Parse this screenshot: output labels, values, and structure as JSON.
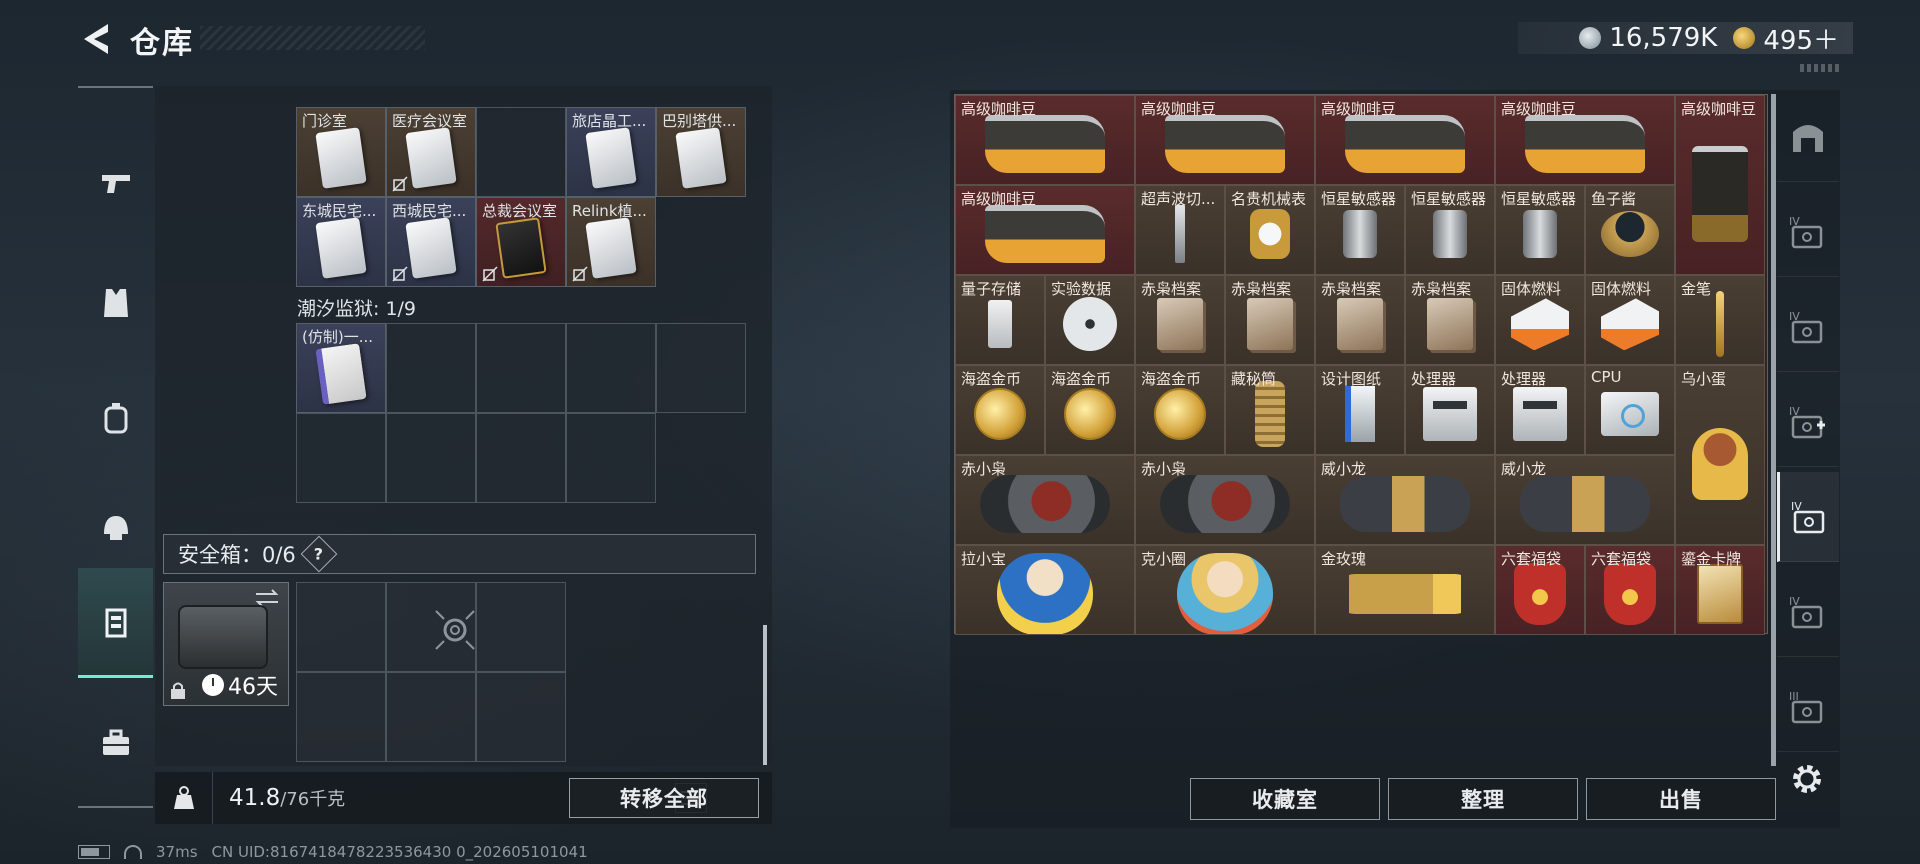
{
  "header": {
    "title": "仓库",
    "currencies": [
      {
        "icon": "silver-coin-icon",
        "value": "16,579K"
      },
      {
        "icon": "gold-coin-icon",
        "value": "495＋"
      }
    ]
  },
  "sidebar": {
    "items": [
      {
        "name": "pistol-icon",
        "active": false
      },
      {
        "name": "vest-icon",
        "active": false
      },
      {
        "name": "backpack-icon",
        "active": false
      },
      {
        "name": "helmet-icon",
        "active": false
      },
      {
        "name": "safebox-icon",
        "active": true
      },
      {
        "name": "toolbox-icon",
        "active": false
      }
    ]
  },
  "stash": {
    "keycards": [
      {
        "label": "门诊室",
        "color": "brown",
        "nocopy": false
      },
      {
        "label": "医疗会议室",
        "color": "brown",
        "nocopy": true
      },
      {
        "label": "",
        "color": "empty",
        "nocopy": false
      },
      {
        "label": "旅店晶工...",
        "color": "blue",
        "nocopy": false
      },
      {
        "label": "巴别塔供...",
        "color": "brown",
        "nocopy": false
      },
      {
        "label": "东城民宅...",
        "color": "blue",
        "nocopy": false
      },
      {
        "label": "西城民宅...",
        "color": "blue",
        "nocopy": true
      },
      {
        "label": "总裁会议室",
        "color": "red",
        "nocopy": true
      },
      {
        "label": "Relink植...",
        "color": "brown",
        "nocopy": true
      }
    ],
    "prison_label": "潮汐监狱: 1/9",
    "prison_items": [
      {
        "label": "(仿制)一..."
      }
    ],
    "safebox": {
      "label": "安全箱：0/6",
      "help": "?",
      "timer": "46天"
    },
    "weight": {
      "current": "41.8",
      "max": "/76千克"
    },
    "transfer_all": "转移全部"
  },
  "status_bar": {
    "ping": "37ms",
    "uid": "CN UID:8167418478223536430 0_202605101041"
  },
  "container_items": [
    {
      "label": "高级咖啡豆",
      "col": 0,
      "row": 0,
      "w": 2,
      "h": 1,
      "color": "red",
      "icon": "bag"
    },
    {
      "label": "高级咖啡豆",
      "col": 2,
      "row": 0,
      "w": 2,
      "h": 1,
      "color": "red",
      "icon": "bag"
    },
    {
      "label": "高级咖啡豆",
      "col": 4,
      "row": 0,
      "w": 2,
      "h": 1,
      "color": "red",
      "icon": "bag"
    },
    {
      "label": "高级咖啡豆",
      "col": 6,
      "row": 0,
      "w": 2,
      "h": 1,
      "color": "red",
      "icon": "bag"
    },
    {
      "label": "高级咖啡豆",
      "col": 8,
      "row": 0,
      "w": 1,
      "h": 2,
      "color": "red",
      "icon": "bag tall"
    },
    {
      "label": "高级咖啡豆",
      "col": 0,
      "row": 1,
      "w": 2,
      "h": 1,
      "color": "red",
      "icon": "bag"
    },
    {
      "label": "超声波切...",
      "col": 2,
      "row": 1,
      "w": 1,
      "h": 1,
      "color": "gold",
      "icon": "knife"
    },
    {
      "label": "名贵机械表",
      "col": 3,
      "row": 1,
      "w": 1,
      "h": 1,
      "color": "gold",
      "icon": "watch"
    },
    {
      "label": "恒星敏感器",
      "col": 4,
      "row": 1,
      "w": 1,
      "h": 1,
      "color": "gold",
      "icon": "sensor"
    },
    {
      "label": "恒星敏感器",
      "col": 5,
      "row": 1,
      "w": 1,
      "h": 1,
      "color": "gold",
      "icon": "sensor"
    },
    {
      "label": "恒星敏感器",
      "col": 6,
      "row": 1,
      "w": 1,
      "h": 1,
      "color": "gold",
      "icon": "sensor"
    },
    {
      "label": "鱼子酱",
      "col": 7,
      "row": 1,
      "w": 1,
      "h": 1,
      "color": "gold",
      "icon": "tin"
    },
    {
      "label": "量子存储",
      "col": 0,
      "row": 2,
      "w": 1,
      "h": 1,
      "color": "gold",
      "icon": "usb"
    },
    {
      "label": "实验数据",
      "col": 1,
      "row": 2,
      "w": 1,
      "h": 1,
      "color": "gold",
      "icon": "disc"
    },
    {
      "label": "赤枭档案",
      "col": 2,
      "row": 2,
      "w": 1,
      "h": 1,
      "color": "gold",
      "icon": "dossier"
    },
    {
      "label": "赤枭档案",
      "col": 3,
      "row": 2,
      "w": 1,
      "h": 1,
      "color": "gold",
      "icon": "dossier"
    },
    {
      "label": "赤枭档案",
      "col": 4,
      "row": 2,
      "w": 1,
      "h": 1,
      "color": "gold",
      "icon": "dossier"
    },
    {
      "label": "赤枭档案",
      "col": 5,
      "row": 2,
      "w": 1,
      "h": 1,
      "color": "gold",
      "icon": "dossier"
    },
    {
      "label": "固体燃料",
      "col": 6,
      "row": 2,
      "w": 1,
      "h": 1,
      "color": "gold",
      "icon": "fuel"
    },
    {
      "label": "固体燃料",
      "col": 7,
      "row": 2,
      "w": 1,
      "h": 1,
      "color": "gold",
      "icon": "fuel"
    },
    {
      "label": "金笔",
      "col": 8,
      "row": 2,
      "w": 1,
      "h": 1,
      "color": "gold",
      "icon": "pen"
    },
    {
      "label": "海盗金币",
      "col": 0,
      "row": 3,
      "w": 1,
      "h": 1,
      "color": "gold",
      "icon": "coinimg"
    },
    {
      "label": "海盗金币",
      "col": 1,
      "row": 3,
      "w": 1,
      "h": 1,
      "color": "gold",
      "icon": "coinimg"
    },
    {
      "label": "海盗金币",
      "col": 2,
      "row": 3,
      "w": 1,
      "h": 1,
      "color": "gold",
      "icon": "coinimg"
    },
    {
      "label": "藏秘筒",
      "col": 3,
      "row": 3,
      "w": 1,
      "h": 1,
      "color": "gold",
      "icon": "scroll"
    },
    {
      "label": "设计图纸",
      "col": 4,
      "row": 3,
      "w": 1,
      "h": 1,
      "color": "gold",
      "icon": "paper"
    },
    {
      "label": "处理器",
      "col": 5,
      "row": 3,
      "w": 1,
      "h": 1,
      "color": "gold",
      "icon": "cpu-box"
    },
    {
      "label": "处理器",
      "col": 6,
      "row": 3,
      "w": 1,
      "h": 1,
      "color": "gold",
      "icon": "cpu-box"
    },
    {
      "label": "CPU",
      "col": 7,
      "row": 3,
      "w": 1,
      "h": 1,
      "color": "gold",
      "icon": "chip"
    },
    {
      "label": "乌小蛋",
      "col": 8,
      "row": 3,
      "w": 1,
      "h": 2,
      "color": "gold",
      "icon": "figure egg"
    },
    {
      "label": "赤小枭",
      "col": 0,
      "row": 4,
      "w": 2,
      "h": 1,
      "color": "gold",
      "icon": "figure bird"
    },
    {
      "label": "赤小枭",
      "col": 2,
      "row": 4,
      "w": 2,
      "h": 1,
      "color": "gold",
      "icon": "figure bird"
    },
    {
      "label": "威小龙",
      "col": 4,
      "row": 4,
      "w": 2,
      "h": 1,
      "color": "gold",
      "icon": "figure dragon"
    },
    {
      "label": "威小龙",
      "col": 6,
      "row": 4,
      "w": 2,
      "h": 1,
      "color": "gold",
      "icon": "figure dragon"
    },
    {
      "label": "拉小宝",
      "col": 0,
      "row": 5,
      "w": 2,
      "h": 1,
      "color": "gold",
      "icon": "figure kid"
    },
    {
      "label": "克小圈",
      "col": 2,
      "row": 5,
      "w": 2,
      "h": 1,
      "color": "gold",
      "icon": "figure kid2"
    },
    {
      "label": "金玫瑰",
      "col": 4,
      "row": 5,
      "w": 2,
      "h": 1,
      "color": "gold",
      "icon": "rose"
    },
    {
      "label": "六套福袋",
      "col": 6,
      "row": 5,
      "w": 1,
      "h": 1,
      "color": "red",
      "icon": "lucky"
    },
    {
      "label": "六套福袋",
      "col": 7,
      "row": 5,
      "w": 1,
      "h": 1,
      "color": "red",
      "icon": "lucky"
    },
    {
      "label": "鎏金卡牌",
      "col": 8,
      "row": 5,
      "w": 1,
      "h": 1,
      "color": "red",
      "icon": "card-gold"
    }
  ],
  "actions": {
    "collection": "收藏室",
    "sort": "整理",
    "sell": "出售"
  },
  "right_sidebar": {
    "items": [
      {
        "name": "home-base-icon",
        "active": false
      },
      {
        "name": "tier-iv-case-icon",
        "active": false
      },
      {
        "name": "tier-iv-case-icon",
        "active": false
      },
      {
        "name": "tier-iv-medkit-icon",
        "active": false
      },
      {
        "name": "tier-iv-case-icon",
        "active": true
      },
      {
        "name": "tier-iv-case-icon",
        "active": false
      },
      {
        "name": "tier-iii-case-icon",
        "active": false
      }
    ]
  }
}
